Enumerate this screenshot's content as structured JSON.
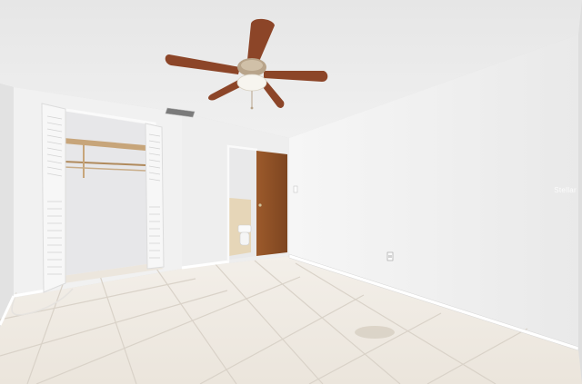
{
  "photo": {
    "watermark": "Stellar",
    "colors": {
      "ceiling": "#ececec",
      "wall_light": "#f4f4f4",
      "wall_shade": "#e4e4e4",
      "floor": "#f1ece6",
      "grout": "#d8d2ca",
      "door_wood": "#8a4f24",
      "fan_blade": "#8c4528"
    }
  }
}
